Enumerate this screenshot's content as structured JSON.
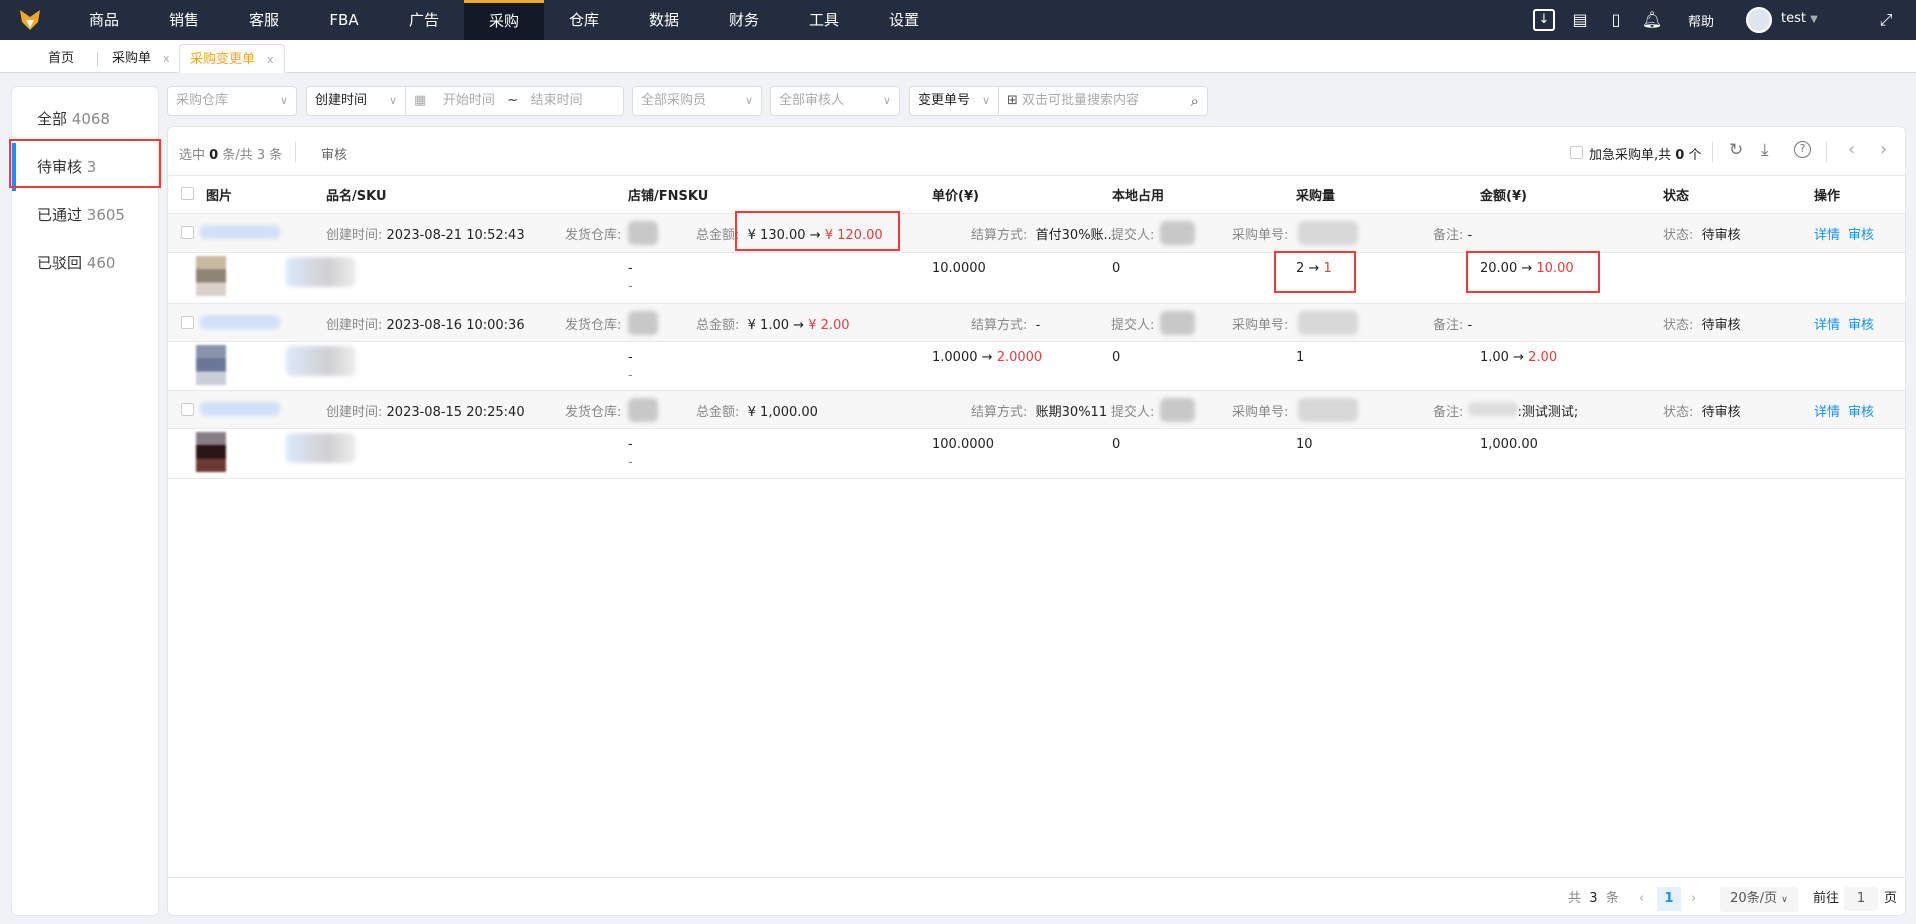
{
  "nav": {
    "items": [
      "商品",
      "销售",
      "客服",
      "FBA",
      "广告",
      "采购",
      "仓库",
      "数据",
      "财务",
      "工具",
      "设置"
    ],
    "active": "采购",
    "help": "帮助",
    "user": "test"
  },
  "tabs": [
    {
      "label": "首页"
    },
    {
      "label": "采购单",
      "close": "x"
    },
    {
      "label": "采购变更单",
      "close": "x"
    }
  ],
  "sidebar": [
    {
      "label": "全部",
      "count": "4068"
    },
    {
      "label": "待审核",
      "count": "3"
    },
    {
      "label": "已通过",
      "count": "3605"
    },
    {
      "label": "已驳回",
      "count": "460"
    }
  ],
  "filters": {
    "warehouse": "采购仓库",
    "time_type": "创建时间",
    "start": "开始时间",
    "tilde": "~",
    "end": "结束时间",
    "buyer": "全部采购员",
    "reviewer": "全部审核人",
    "search_type": "变更单号",
    "search_placeholder": "双击可批量搜索内容"
  },
  "toolbar": {
    "selected_prefix": "选中",
    "selected": "0",
    "selected_mid": "条/共",
    "total": "3",
    "selected_suffix": "条",
    "review": "审核",
    "urgent_label": "加急采购单,共",
    "urgent_count": "0",
    "urgent_suffix": "个"
  },
  "columns": [
    "图片",
    "品名/SKU",
    "店铺/FNSKU",
    "单价(¥)",
    "本地占用",
    "采购量",
    "金额(¥)",
    "状态",
    "操作"
  ],
  "labels": {
    "created": "创建时间:",
    "warehouse": "发货仓库:",
    "total": "总金额:",
    "settle": "结算方式:",
    "submitter": "提交人:",
    "po": "采购单号:",
    "remark": "备注:",
    "status": "状态:",
    "detail": "详情",
    "review": "审核",
    "arrow": "→"
  },
  "rows": [
    {
      "created": "2023-08-21 10:52:43",
      "total_old": "¥ 130.00",
      "total_new": "¥ 120.00",
      "settle": "首付30%账...",
      "remark": "-",
      "status": "待审核",
      "shop": "-",
      "fnsku": "-",
      "price_old": "10.0000",
      "price_new": "",
      "local": "0",
      "qty_old": "2",
      "qty_new": "1",
      "amt_old": "20.00",
      "amt_new": "10.00"
    },
    {
      "created": "2023-08-16 10:00:36",
      "total_old": "¥ 1.00",
      "total_new": "¥ 2.00",
      "settle": "-",
      "remark": "-",
      "status": "待审核",
      "shop": "-",
      "fnsku": "-",
      "price_old": "1.0000",
      "price_new": "2.0000",
      "local": "0",
      "qty_old": "1",
      "qty_new": "",
      "amt_old": "1.00",
      "amt_new": "2.00"
    },
    {
      "created": "2023-08-15 20:25:40",
      "total_old": "¥ 1,000.00",
      "total_new": "",
      "settle": "账期30%11",
      "remark": ":测试测试;",
      "status": "待审核",
      "shop": "-",
      "fnsku": "-",
      "price_old": "100.0000",
      "price_new": "",
      "local": "0",
      "qty_old": "10",
      "qty_new": "",
      "amt_old": "1,000.00",
      "amt_new": ""
    }
  ],
  "pagination": {
    "total_prefix": "共",
    "total": "3",
    "total_suffix": "条",
    "page": "1",
    "page_size": "20条/页",
    "goto": "前往",
    "goto_value": "1",
    "goto_suffix": "页"
  }
}
